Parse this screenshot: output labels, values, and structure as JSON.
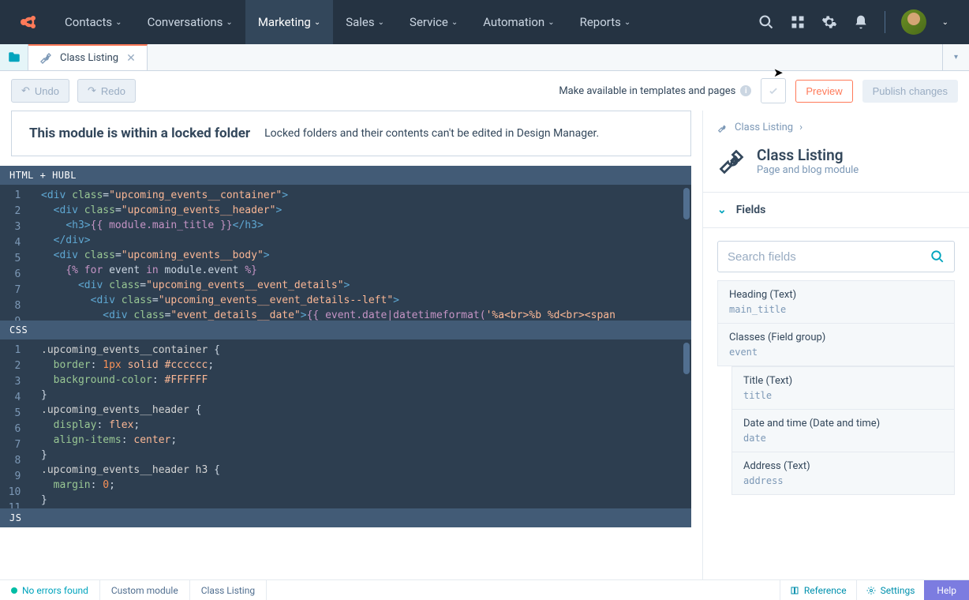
{
  "nav": {
    "items": [
      "Contacts",
      "Conversations",
      "Marketing",
      "Sales",
      "Service",
      "Automation",
      "Reports"
    ],
    "active_index": 2
  },
  "tab": {
    "label": "Class Listing"
  },
  "toolbar": {
    "undo": "Undo",
    "redo": "Redo",
    "availability": "Make available in templates and pages",
    "preview": "Preview",
    "publish": "Publish changes"
  },
  "banner": {
    "title": "This module is within a locked folder",
    "desc": "Locked folders and their contents can't be edited in Design Manager."
  },
  "editors": {
    "html_label": "HTML + HUBL",
    "css_label": "CSS",
    "js_label": "JS"
  },
  "sidebar": {
    "crumb": "Class Listing",
    "module_title": "Class Listing",
    "module_sub": "Page and blog module",
    "fields_header": "Fields",
    "search_placeholder": "Search fields",
    "fields": [
      {
        "label": "Heading (Text)",
        "key": "main_title"
      },
      {
        "label": "Classes (Field group)",
        "key": "event"
      },
      {
        "label": "Title (Text)",
        "key": "title",
        "nested": true
      },
      {
        "label": "Date and time (Date and time)",
        "key": "date",
        "nested": true
      },
      {
        "label": "Address (Text)",
        "key": "address",
        "nested": true
      }
    ]
  },
  "status": {
    "errors": "No errors found",
    "type": "Custom module",
    "name": "Class Listing",
    "reference": "Reference",
    "settings": "Settings",
    "help": "Help"
  }
}
